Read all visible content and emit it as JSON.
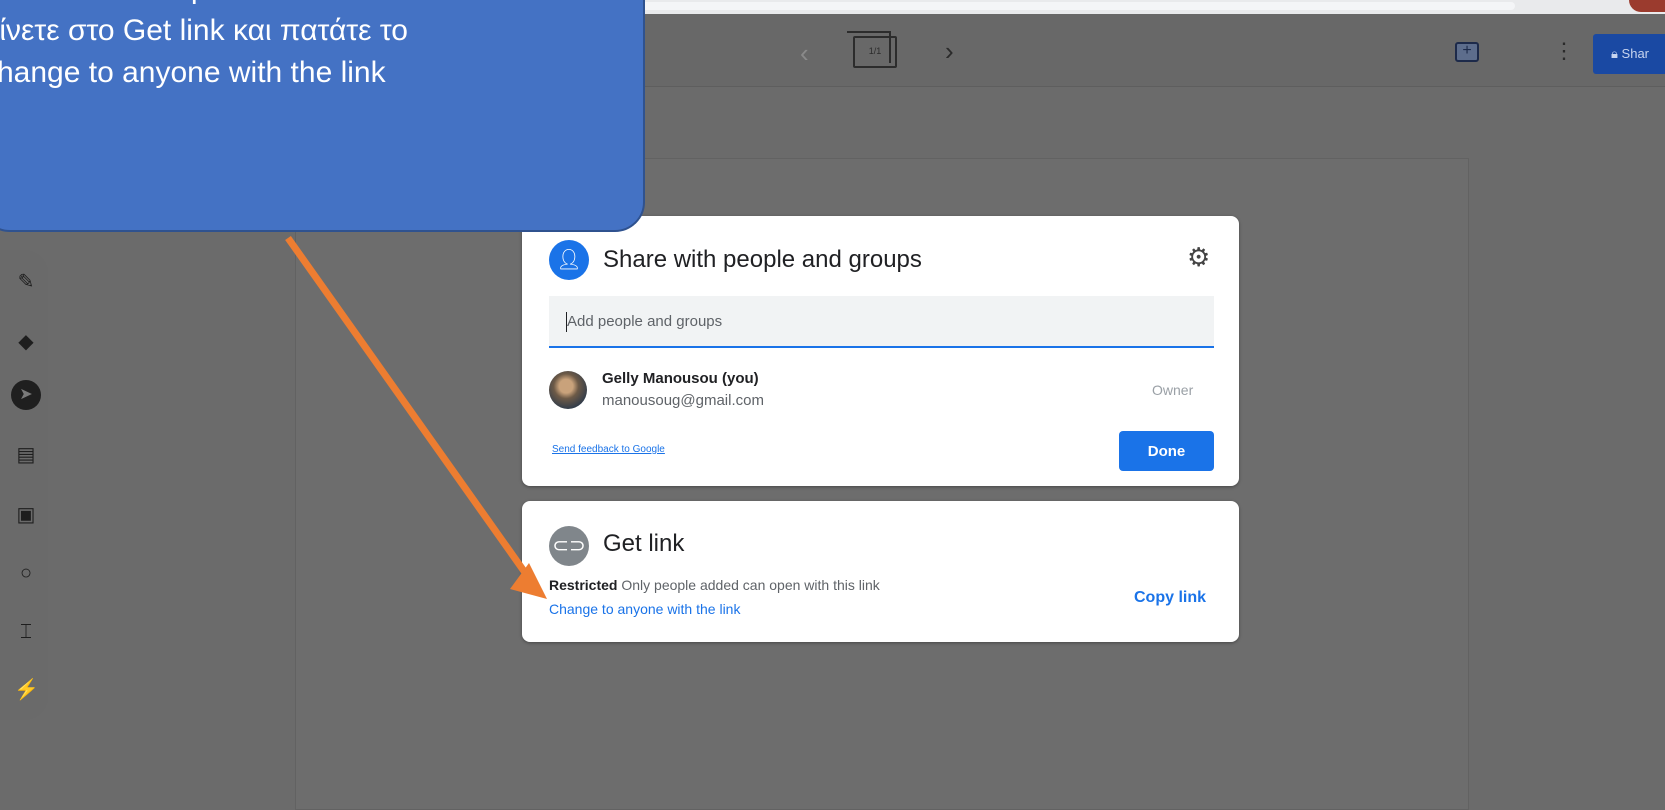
{
  "callout": {
    "line1": "Παρακάτω",
    "line2": "αίνετε στο Get link και πατάτε το",
    "line3": "change to anyone with the link"
  },
  "toolbar": {
    "slide_counter": "1/1",
    "share_label": "Shar"
  },
  "share_dialog": {
    "title": "Share with people and groups",
    "input_placeholder": "Add people and groups",
    "user": {
      "name": "Gelly Manousou (you)",
      "email": "manousoug@gmail.com",
      "role": "Owner"
    },
    "feedback_link": "Send feedback to Google",
    "done_label": "Done"
  },
  "get_link": {
    "title": "Get link",
    "restricted_label": "Restricted",
    "restricted_text": "Only people added can open with this link",
    "change_link": "Change to anyone with the link",
    "copy_link": "Copy link"
  },
  "colors": {
    "accent_blue": "#1a73e8",
    "callout_blue": "#4472c4",
    "arrow_orange": "#ed7d31"
  }
}
